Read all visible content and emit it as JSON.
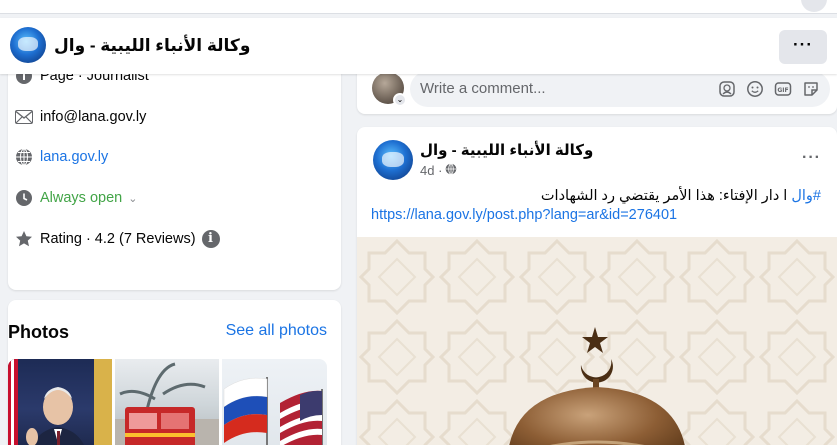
{
  "header": {
    "page_name": "وكالة الأنباء الليبية - وال",
    "more_label": "···"
  },
  "intro": {
    "category": "Page · Journalist",
    "email": "info@lana.gov.ly",
    "website": "lana.gov.ly",
    "hours": "Always open",
    "rating": "Rating · 4.2 (7 Reviews)",
    "info_glyph": "i"
  },
  "photos": {
    "title": "Photos",
    "see_all": "See all photos"
  },
  "comment": {
    "placeholder": "Write a comment..."
  },
  "post": {
    "author": "وكالة الأنباء الليبية - وال",
    "time": "4d ·",
    "more_label": "···",
    "hashtag": "#وال",
    "text": " ا دار الإفتاء: هذا الأمر يقتضي رد الشهادات",
    "url": "https://lana.gov.ly/post.php?lang=ar&id=276401"
  },
  "colors": {
    "link": "#1b74e4",
    "open_status": "#42a447",
    "background": "#f0f2f5"
  },
  "icons": [
    "page-icon",
    "envelope-icon",
    "globe-icon",
    "clock-icon",
    "star-icon",
    "info-icon",
    "chevron-down-icon",
    "globe-audience-icon",
    "gif-icon",
    "sticker-icon",
    "emoji-icon",
    "avatar-sticker-icon"
  ]
}
